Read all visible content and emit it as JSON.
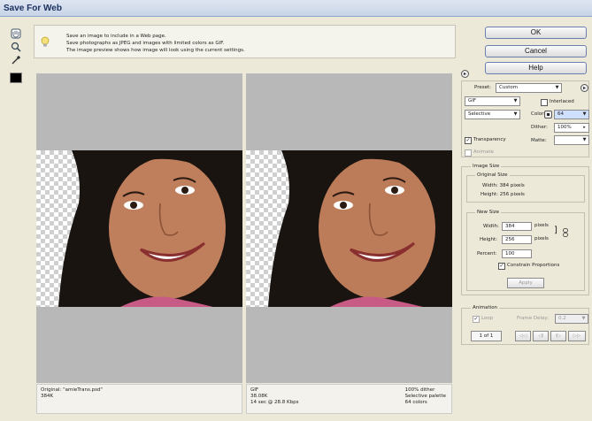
{
  "window": {
    "title": "Save For Web"
  },
  "toolbox": {
    "tools": [
      "hand-icon",
      "zoom-icon",
      "eyedropper-icon"
    ],
    "swatch_color": "#000000"
  },
  "info": {
    "lines": [
      "Save an image to include in a Web page.",
      "Save photographs as JPEG and images with limited colors as GIF.",
      "The image preview shows how image will look using the current settings."
    ]
  },
  "preview_original": {
    "name": "Original: \"amieTrans.psd\"",
    "size": "384K"
  },
  "preview_optimized": {
    "format": "GIF",
    "size": "38.08K",
    "time": "14 sec @ 28.8 Kbps",
    "dither": "100% dither",
    "palette": "Selective palette",
    "colors": "64 colors"
  },
  "buttons": {
    "ok": "OK",
    "cancel": "Cancel",
    "help": "Help"
  },
  "settings": {
    "preset_label": "Preset:",
    "preset_value": "Custom",
    "format_value": "GIF",
    "interlaced_label": "Interlaced",
    "palette_value": "Selective",
    "colors_label": "Colors:",
    "colors_value": "64",
    "dither_label": "Dither:",
    "dither_value": "100%",
    "transparency_label": "Transparency",
    "matte_label": "Matte:",
    "animate_label": "Animate"
  },
  "image_size": {
    "title": "Image Size",
    "original_title": "Original Size",
    "width_text": "Width: 384 pixels",
    "height_text": "Height: 256 pixels",
    "new_title": "New Size",
    "width_label": "Width:",
    "width_value": "384",
    "height_label": "Height:",
    "height_value": "256",
    "unit": "pixels",
    "percent_label": "Percent:",
    "percent_value": "100",
    "constrain_label": "Constrain Proportions",
    "apply_label": "Apply"
  },
  "animation": {
    "title": "Animation",
    "loop_label": "Loop",
    "frame_delay_label": "Frame Delay:",
    "frame_delay_value": "0.2",
    "frame_counter": "1 of 1",
    "nav": [
      "◁◁",
      "◁I",
      "I▷",
      "▷▷"
    ]
  }
}
